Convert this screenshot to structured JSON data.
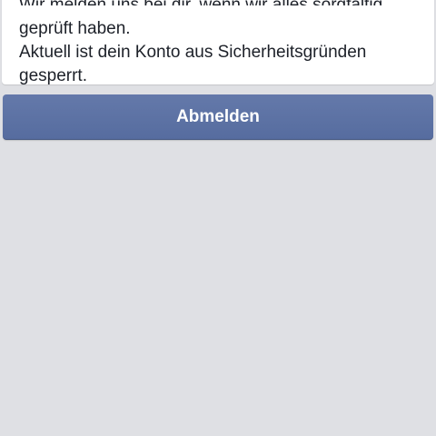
{
  "message": {
    "clipped_line": "Wir melden uns bei dir, wenn wir alles sorgfältig,",
    "line_1": "geprüft haben.",
    "line_2": "Aktuell ist dein Konto aus Sicherheitsgründen",
    "line_3": "gesperrt."
  },
  "actions": {
    "logout_label": "Abmelden"
  },
  "colors": {
    "background": "#dfe0e4",
    "card": "#ffffff",
    "button": "#5b70a3",
    "text": "#1d2129"
  }
}
